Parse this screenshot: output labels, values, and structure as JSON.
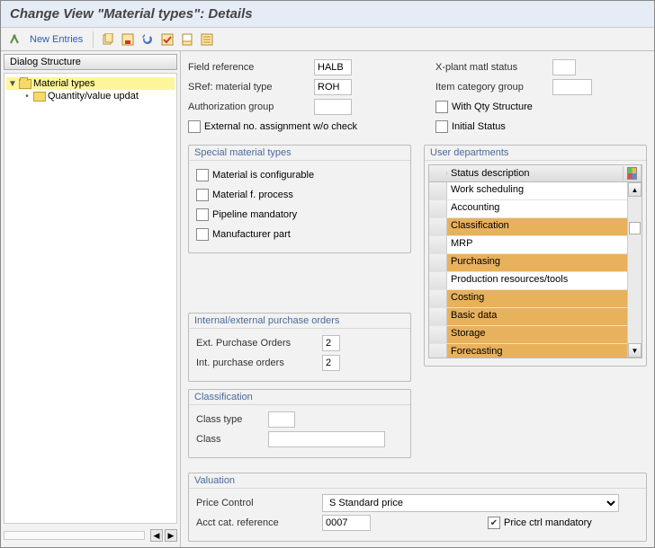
{
  "title": "Change View \"Material types\": Details",
  "toolbar": {
    "new_entries": "New Entries"
  },
  "dialog_structure": {
    "header": "Dialog Structure",
    "nodes": [
      {
        "label": "Material types",
        "selected": true,
        "level": 0
      },
      {
        "label": "Quantity/value updat",
        "selected": false,
        "level": 1
      }
    ]
  },
  "fields": {
    "field_reference": {
      "label": "Field reference",
      "value": "HALB"
    },
    "sref_mat_type": {
      "label": "SRef: material type",
      "value": "ROH"
    },
    "auth_group": {
      "label": "Authorization group",
      "value": ""
    },
    "ext_no_assign": {
      "label": "External no. assignment w/o check",
      "checked": false
    },
    "xplant_status": {
      "label": "X-plant matl status",
      "value": ""
    },
    "item_cat_group": {
      "label": "Item category group",
      "value": ""
    },
    "with_qty": {
      "label": "With Qty Structure",
      "checked": false
    },
    "initial_status": {
      "label": "Initial Status",
      "checked": false
    }
  },
  "special_material_types": {
    "title": "Special material types",
    "configurable": {
      "label": "Material is configurable",
      "checked": false
    },
    "process": {
      "label": "Material f. process",
      "checked": false
    },
    "pipeline": {
      "label": "Pipeline mandatory",
      "checked": false
    },
    "manufacturer": {
      "label": "Manufacturer part",
      "checked": false
    }
  },
  "user_departments": {
    "title": "User departments",
    "column": "Status description",
    "rows": [
      {
        "label": "Work scheduling",
        "selected": false
      },
      {
        "label": "Accounting",
        "selected": false
      },
      {
        "label": "Classification",
        "selected": true
      },
      {
        "label": "MRP",
        "selected": false
      },
      {
        "label": "Purchasing",
        "selected": true
      },
      {
        "label": "Production resources/tools",
        "selected": false
      },
      {
        "label": "Costing",
        "selected": true
      },
      {
        "label": "Basic data",
        "selected": true
      },
      {
        "label": "Storage",
        "selected": true
      },
      {
        "label": "Forecasting",
        "selected": true
      }
    ]
  },
  "purchase_orders": {
    "title": "Internal/external purchase orders",
    "ext": {
      "label": "Ext. Purchase Orders",
      "value": "2"
    },
    "int": {
      "label": "Int. purchase orders",
      "value": "2"
    }
  },
  "classification": {
    "title": "Classification",
    "class_type": {
      "label": "Class type",
      "value": ""
    },
    "class": {
      "label": "Class",
      "value": ""
    }
  },
  "valuation": {
    "title": "Valuation",
    "price_control": {
      "label": "Price Control",
      "value": "S Standard price"
    },
    "acct_cat": {
      "label": "Acct cat. reference",
      "value": "0007"
    },
    "price_mandatory": {
      "label": "Price ctrl mandatory",
      "checked": true
    }
  }
}
